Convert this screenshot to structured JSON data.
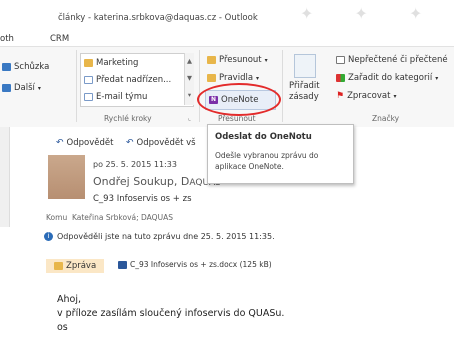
{
  "window": {
    "title": "články - katerina.srbkova@daquas.cz - Outlook"
  },
  "tabs": [
    "oth",
    "CRM"
  ],
  "ribbon": {
    "move_group": {
      "schuzka": "Schůzka",
      "dalsi": "Další"
    },
    "quick_steps": {
      "items": [
        "Marketing",
        "Předat nadřízen...",
        "E-mail týmu"
      ],
      "label": "Rychlé kroky"
    },
    "presunout_group": {
      "presunout": "Přesunout",
      "pravidla": "Pravidla",
      "onenote": "OneNote",
      "label": "Přesunout"
    },
    "zasady": {
      "line1": "Přiřadit",
      "line2": "zásady"
    },
    "tags": {
      "unread": "Nepřečtené či přečtené",
      "categorize": "Zařadit do kategorií",
      "followup": "Zpracovat",
      "label": "Značky"
    }
  },
  "tooltip": {
    "title": "Odeslat do OneNotu",
    "description": "Odešle vybranou zprávu do aplikace OneNote."
  },
  "message": {
    "reply": "Odpovědět",
    "reply_all": "Odpovědět vš",
    "date": "po 25. 5. 2015 11:33",
    "sender": "Ondřej Soukup, D",
    "sender_suffix": "AQUAS",
    "subject": "C_93 Infoservis os + zs",
    "to_label": "Komu",
    "to_value": "Kateřina Srbková; DAQUAS",
    "info": "Odpověděli jste na tuto zprávu dne 25. 5. 2015 11:35.",
    "attach_tab": "Zpráva",
    "attachment": "C_93 Infoservis os + zs.docx (125 kB)",
    "body": [
      "Ahoj,",
      "v příloze zasílám sloučený infoservis do QUASu.",
      "os"
    ]
  },
  "colors": {
    "accent": "#2b579a",
    "highlight_circle": "#e32b2b",
    "onenote": "#7b2fa8"
  }
}
